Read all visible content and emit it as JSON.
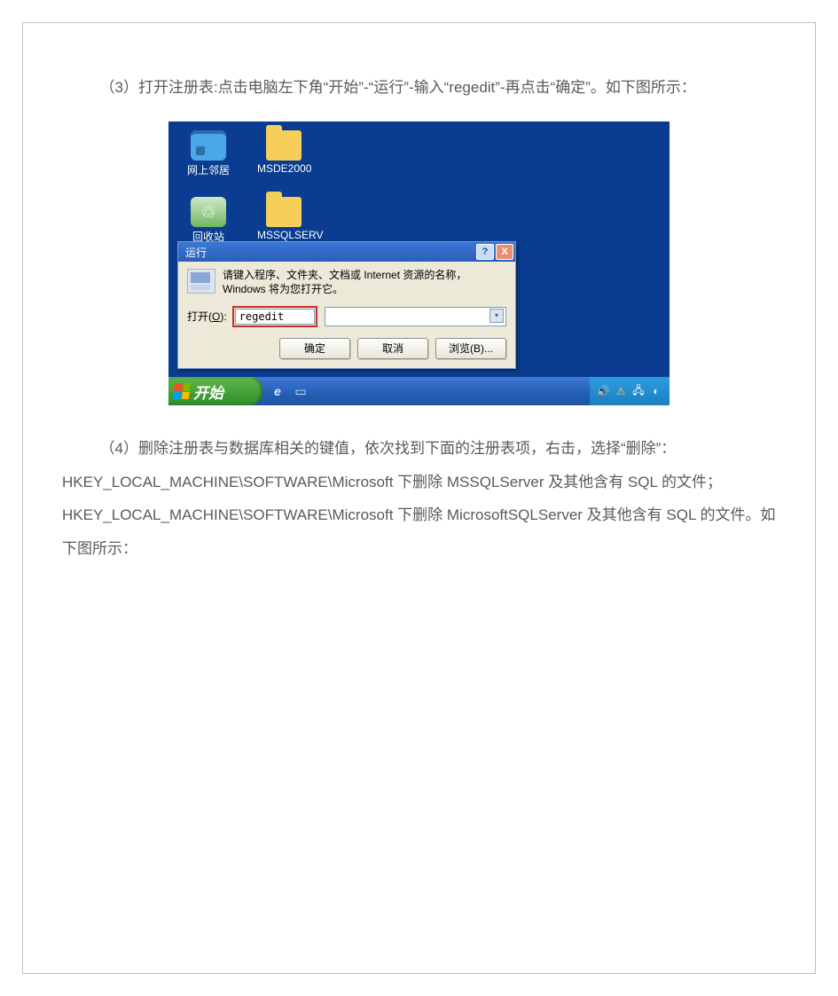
{
  "doc": {
    "para3": "（3）打开注册表:点击电脑左下角“开始”-“运行”-输入“regedit”-再点击“确定”。如下图所示：",
    "para4": "（4）删除注册表与数据库相关的键值，依次找到下面的注册表项，右击，选择“删除”：HKEY_LOCAL_MACHINE\\SOFTWARE\\Microsoft  下删除 MSSQLServer 及其他含有 SQL 的文件；HKEY_LOCAL_MACHINE\\SOFTWARE\\Microsoft  下删除 MicrosoftSQLServer 及其他含有 SQL 的文件。如下图所示："
  },
  "desktop": {
    "icon_network": "网上邻居",
    "icon_folder1": "MSDE2000",
    "icon_recycle": "回收站",
    "icon_folder2": "MSSQLSERV"
  },
  "dialog": {
    "title": "运行",
    "helpbtn": "?",
    "closebtn": "X",
    "message": "请键入程序、文件夹、文档或 Internet 资源的名称，Windows 将为您打开它。",
    "open_label_pre": "打开(",
    "open_label_key": "O",
    "open_label_post": "):",
    "input_value": "regedit",
    "btn_ok": "确定",
    "btn_cancel": "取消",
    "btn_browse": "浏览(B)..."
  },
  "taskbar": {
    "start": "开始",
    "ie_icon": "e",
    "tray_time_placeholder": ""
  }
}
